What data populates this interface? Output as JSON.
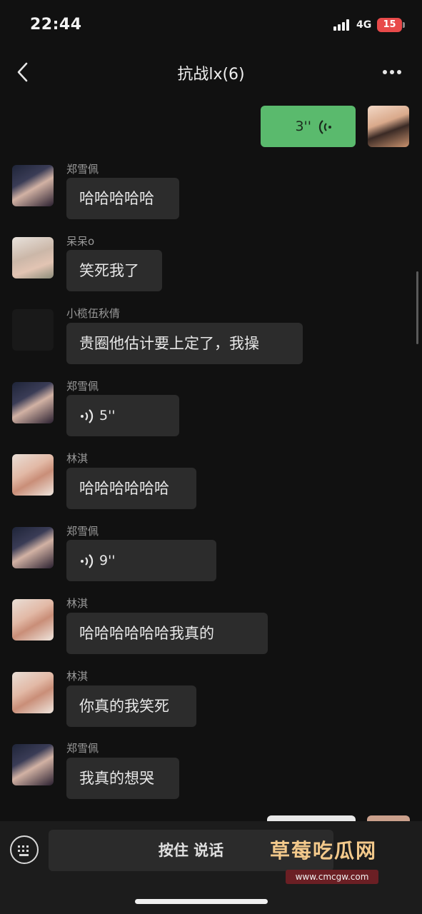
{
  "status_bar": {
    "time": "22:44",
    "network": "4G",
    "battery": "15",
    "battery_color": "#e84a4a"
  },
  "nav": {
    "title": "抗战lx(6)",
    "back_icon": "chevron-left-icon",
    "more_icon": "more-dots-icon"
  },
  "messages": [
    {
      "sender": "",
      "type": "voice",
      "mine": true,
      "text": "3''"
    },
    {
      "sender": "郑雪佩",
      "type": "text",
      "text": "哈哈哈哈哈"
    },
    {
      "sender": "呆呆o",
      "type": "text",
      "text": "笑死我了"
    },
    {
      "sender": "小榄伍秋倩",
      "type": "text",
      "text": "贵圈他估计要上定了，我操"
    },
    {
      "sender": "郑雪佩",
      "type": "voice",
      "text": "5''"
    },
    {
      "sender": "林淇",
      "type": "text",
      "text": "哈哈哈哈哈哈"
    },
    {
      "sender": "郑雪佩",
      "type": "voice",
      "text": "9''"
    },
    {
      "sender": "林淇",
      "type": "text",
      "text": "哈哈哈哈哈哈我真的"
    },
    {
      "sender": "林淇",
      "type": "text",
      "text": "你真的我笑死"
    },
    {
      "sender": "郑雪佩",
      "type": "text",
      "text": "我真的想哭"
    }
  ],
  "input": {
    "hold_to_talk": "按住 说话",
    "keyboard_icon": "keyboard-icon"
  },
  "watermark": {
    "text": "草莓吃瓜网",
    "url": "www.cmcgw.com"
  },
  "colors": {
    "background": "#111111",
    "bubble_other": "#2c2c2c",
    "bubble_mine": "#5aba6d"
  }
}
